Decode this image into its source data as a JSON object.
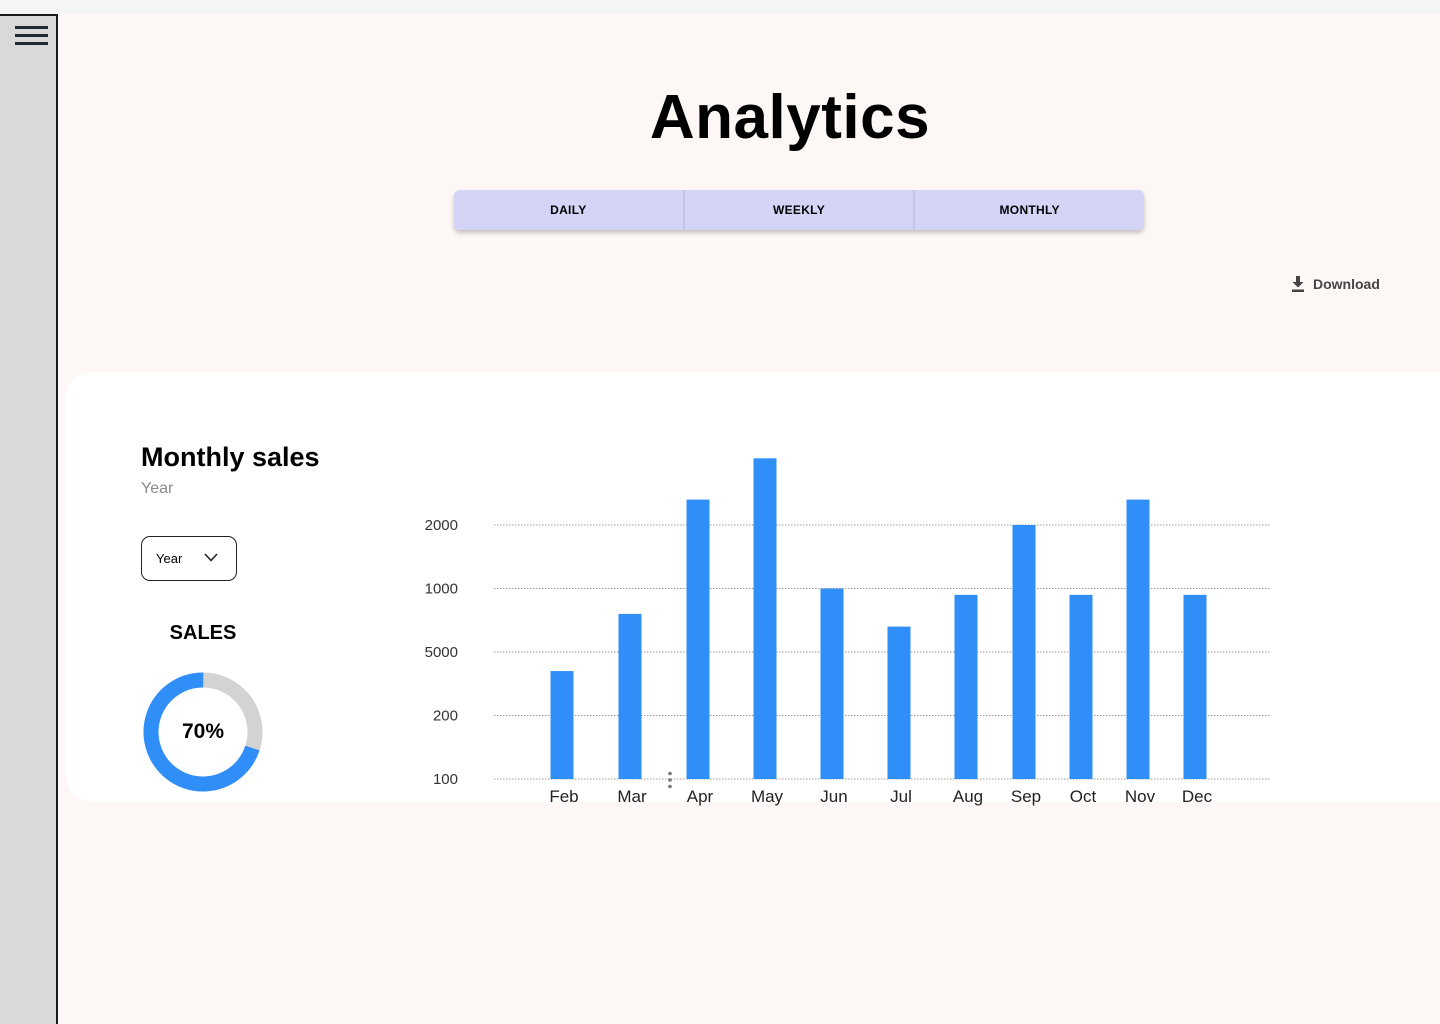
{
  "sidebar": {
    "menu_icon": "hamburger-menu-icon"
  },
  "header": {
    "title": "Analytics"
  },
  "tabs": [
    {
      "label": "DAILY"
    },
    {
      "label": "WEEKLY"
    },
    {
      "label": "MONTHLY"
    }
  ],
  "download": {
    "label": "Download",
    "icon": "download-icon"
  },
  "card": {
    "title": "Monthly sales",
    "subtitle": "Year",
    "select_value": "Year",
    "sales_label": "SALES",
    "sales_percent": "70%",
    "sales_fraction": 0.7
  },
  "colors": {
    "accent": "#308ef8",
    "tab_bg": "#d4d4f7",
    "donut_track": "#d3d3d3",
    "page_bg": "#fdf7f6"
  },
  "chart_data": {
    "type": "bar",
    "categories": [
      "Feb",
      "Mar",
      "Apr",
      "May",
      "Jun",
      "Jul",
      "Aug",
      "Sep",
      "Oct",
      "Nov",
      "Dec"
    ],
    "y_ticks": [
      "100",
      "200",
      "5000",
      "1000",
      "2000"
    ],
    "bar_level": [
      1.7,
      2.6,
      4.4,
      5.05,
      3.0,
      2.4,
      2.9,
      4.0,
      2.9,
      4.4,
      2.9
    ],
    "grid": true,
    "legend": "none"
  }
}
